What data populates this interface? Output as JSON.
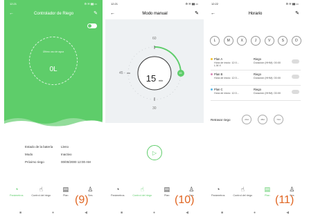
{
  "screens": [
    {
      "status": {
        "time": "12:21",
        "icons": "⚙ ✉ ▮▮ ▭"
      },
      "title": "Controlador de Riego",
      "hero": {
        "label": "Último uso de agua",
        "value": "0L"
      },
      "info": [
        {
          "key": "Estado de la batería",
          "value": "Lleno"
        },
        {
          "key": "Modo",
          "value": "Inactivo"
        },
        {
          "key": "Próximo riego",
          "value": "00/00/2000 12:00 AM"
        }
      ],
      "caption": "(9)"
    },
    {
      "status": {
        "time": "12:21",
        "icons": "⚙ ✉ ▮▮ ▭"
      },
      "title": "Modo manual",
      "dial": {
        "top": "60",
        "left": "45 -",
        "bottom": "30",
        "value": "15",
        "unit": "min",
        "handle": "15"
      },
      "caption": "(10)"
    },
    {
      "status": {
        "time": "12:22",
        "icons": "⚙ ✉ ▮▮ ▭"
      },
      "title": "Horario",
      "days": [
        "L",
        "M",
        "X",
        "J",
        "V",
        "S",
        "D"
      ],
      "plans": [
        {
          "name": "Plan A",
          "start": "Hora de inicio: 12:0...",
          "days": "L.M.X",
          "riego": "Riego",
          "duration": "Duración (HHM): 00:00",
          "color": "#f2c230"
        },
        {
          "name": "Plan B",
          "start": "Hora de inicio: 12:0...",
          "riego": "Riego",
          "duration": "Duración (HHM): 00:00",
          "color": "#d98ab8"
        },
        {
          "name": "Plan C",
          "start": "Hora de inicio: 12:0...",
          "riego": "Riego",
          "duration": "Duración (HHM): 00:00",
          "color": "#5ab8e6"
        }
      ],
      "delay": {
        "label": "Retrasar riego",
        "options": [
          "24H",
          "48H",
          "72H"
        ]
      },
      "caption": "(11)"
    }
  ],
  "nav": {
    "items": [
      {
        "label": "Parámetros",
        "icon": "pie-chart-icon"
      },
      {
        "label": "Control del riego",
        "icon": "hand-icon"
      },
      {
        "label": "Plan",
        "icon": "calendar-icon"
      },
      {
        "label": "Ses",
        "icon": "user-icon"
      }
    ]
  },
  "colors": {
    "accent": "#5ecd6a",
    "caption": "#e06420"
  }
}
